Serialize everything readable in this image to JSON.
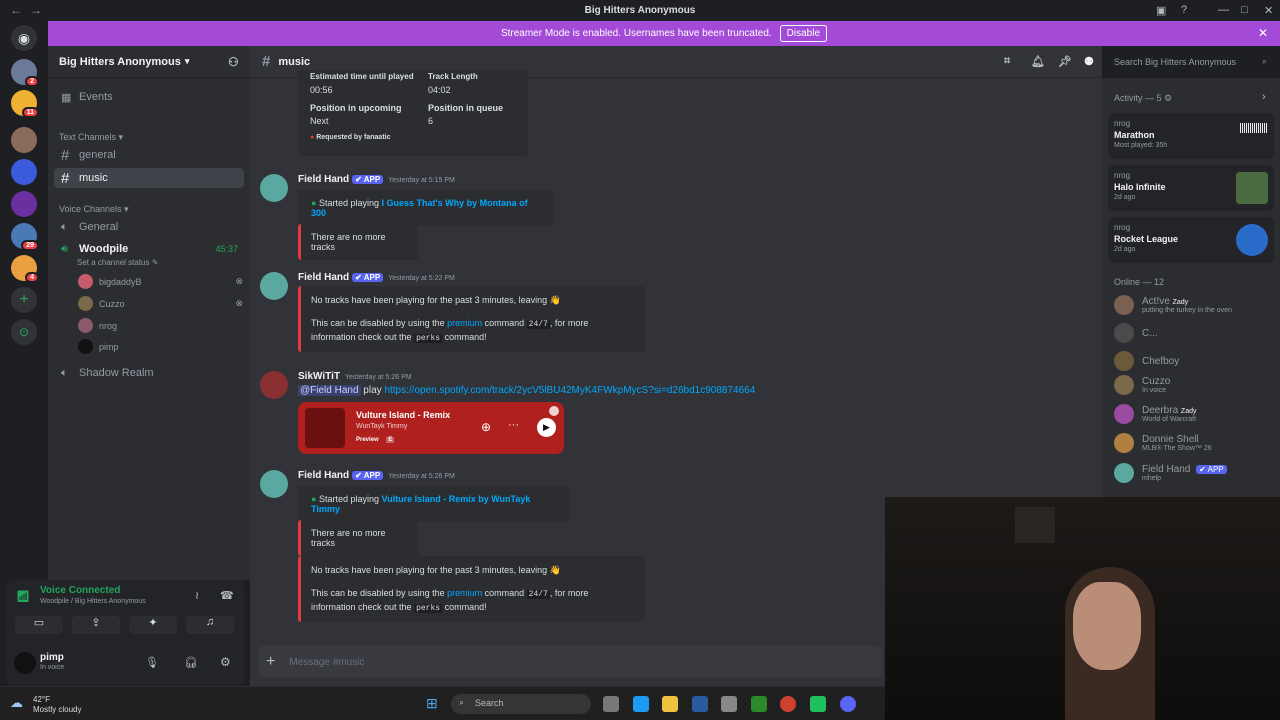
{
  "titlebar": {
    "title": "Big Hitters Anonymous"
  },
  "banner": {
    "text": "Streamer Mode is enabled. Usernames have been truncated.",
    "disable_label": "Disable"
  },
  "guilds": {
    "badges": [
      "2",
      "11",
      "29",
      "4"
    ]
  },
  "server": {
    "name": "Big Hitters Anonymous"
  },
  "sidebar": {
    "events": "Events",
    "text_category": "Text Channels",
    "channels": [
      "general",
      "music"
    ],
    "voice_category": "Voice Channels",
    "voice_general": "General",
    "woodpile": "Woodpile",
    "woodpile_time": "45:37",
    "channel_status": "Set a channel status",
    "voice_users": [
      "bigdaddyB",
      "Cuzzo",
      "nrog",
      "pimp"
    ],
    "shadow_realm": "Shadow Realm"
  },
  "voice_panel": {
    "status": "Voice Connected",
    "location": "Woodpile / Big Hitters Anonymous"
  },
  "user_panel": {
    "name": "pimp",
    "status": "In voice"
  },
  "chat": {
    "channel": "music",
    "search_placeholder": "Search Big Hitters Anonymous",
    "top_embed": {
      "est_label": "Estimated time until played",
      "est_value": "00:56",
      "track_label": "Track Length",
      "track_value": "04:02",
      "upcoming_label": "Position in upcoming",
      "upcoming_value": "Next",
      "queue_label": "Position in queue",
      "queue_value": "6",
      "requested": "Requested by fanaatic"
    },
    "bot_name": "Field Hand",
    "app_tag": "✔ APP",
    "m1_time": "Yesterday at 5:15 PM",
    "m1_started": "Started playing",
    "m1_track": "I Guess That's Why by Montana of 300",
    "no_more": "There are no more tracks",
    "m2_time": "Yesterday at 5:22 PM",
    "idle_text": "No tracks have been playing for the past 3 minutes, leaving 👋",
    "disable_text_1": "This can be disabled by using the",
    "premium": "premium",
    "disable_text_2": "command",
    "cmd_247": "24/7",
    "disable_text_3": ", for more information check out the",
    "cmd_perks": "perks",
    "disable_text_4": "command!",
    "user3": "SikWiTiT",
    "m3_time": "Yesterday at 5:26 PM",
    "mention": "@Field Hand",
    "play": "play",
    "spotify_url": "https://open.spotify.com/track/2ycV5lBU42MyK4FWkpMycS?si=d26bd1c908874664",
    "spotify_title": "Vulture Island - Remix",
    "spotify_artist": "WunTayk Timmy",
    "spotify_preview": "Preview",
    "spotify_e": "E",
    "m4_time": "Yesterday at 5:26 PM",
    "m4_track": "Vulture Island - Remix by WunTayk Timmy",
    "composer_placeholder": "Message #music"
  },
  "members": {
    "activity_label": "Activity — 5",
    "activities": [
      {
        "user": "nrog",
        "game": "Marathon",
        "sub": "Most played: 35h"
      },
      {
        "user": "nrog",
        "game": "Halo Infinite",
        "sub": "2d ago"
      },
      {
        "user": "nrog",
        "game": "Rocket League",
        "sub": "2d ago"
      }
    ],
    "online_label": "Online — 12",
    "list": [
      {
        "name": "Act!ve",
        "tag": "Zady",
        "status": "putting the turkey in the oven"
      },
      {
        "name": "C...",
        "tag": "",
        "status": ""
      },
      {
        "name": "Chefboy",
        "tag": "",
        "status": ""
      },
      {
        "name": "Cuzzo",
        "tag": "",
        "status": "In voice"
      },
      {
        "name": "Deerbra",
        "tag": "Zady",
        "status": "World of Warcraft"
      },
      {
        "name": "Donnie Shell",
        "tag": "",
        "status": "MLB® The Show™ 26"
      },
      {
        "name": "Field Hand",
        "tag": "✔ APP",
        "status": "mhelp"
      }
    ]
  },
  "taskbar": {
    "temp": "42°F",
    "weather": "Mostly cloudy",
    "search": "Search"
  },
  "colors": {
    "accent": "#5865f2",
    "banner": "#a34bd6",
    "online": "#23a55a"
  }
}
